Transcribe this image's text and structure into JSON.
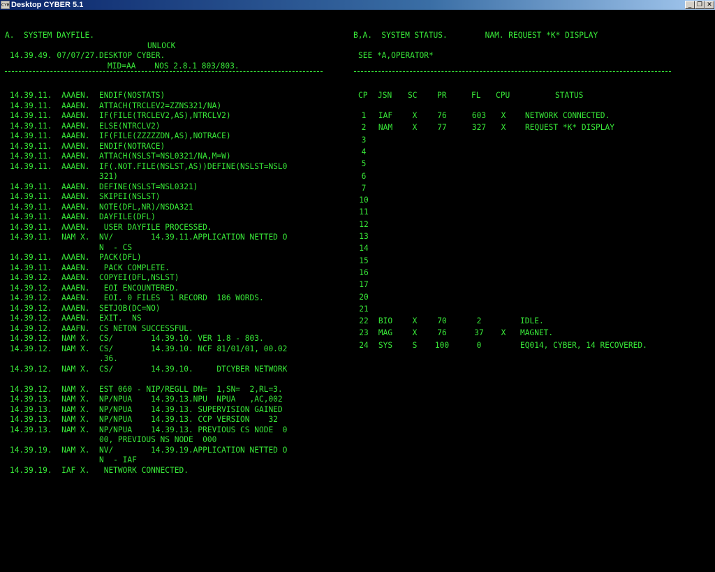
{
  "window": {
    "title": "Desktop CYBER 5.1",
    "icon_text": "CYB",
    "buttons": {
      "minimize": "_",
      "restore": "❐",
      "close": "✕"
    }
  },
  "dayfile": {
    "header": "A.  SYSTEM DAYFILE.",
    "unlock": "UNLOCK",
    "banner1": "14.39.49. 07/07/27.DESKTOP CYBER.",
    "banner2": "MID=AA    NOS 2.8.1 803/803.",
    "lines": [
      "14.39.11.  AAAEN.  ENDIF(NOSTATS)",
      "14.39.11.  AAAEN.  ATTACH(TRCLEV2=ZZNS321/NA)",
      "14.39.11.  AAAEN.  IF(FILE(TRCLEV2,AS),NTRCLV2)",
      "14.39.11.  AAAEN.  ELSE(NTRCLV2)",
      "14.39.11.  AAAEN.  IF(FILE(ZZZZZDN,AS),NOTRACE)",
      "14.39.11.  AAAEN.  ENDIF(NOTRACE)",
      "14.39.11.  AAAEN.  ATTACH(NSLST=NSL0321/NA,M=W)",
      "14.39.11.  AAAEN.  IF(.NOT.FILE(NSLST,AS))DEFINE(NSLST=NSL0",
      "                   321)",
      "14.39.11.  AAAEN.  DEFINE(NSLST=NSL0321)",
      "14.39.11.  AAAEN.  SKIPEI(NSLST)",
      "14.39.11.  AAAEN.  NOTE(DFL,NR)/NSDA321",
      "14.39.11.  AAAEN.  DAYFILE(DFL)",
      "14.39.11.  AAAEN.   USER DAYFILE PROCESSED.",
      "14.39.11.  NAM X.  NV/        14.39.11.APPLICATION NETTED O",
      "                   N  - CS",
      "14.39.11.  AAAEN.  PACK(DFL)",
      "14.39.11.  AAAEN.   PACK COMPLETE.",
      "14.39.12.  AAAEN.  COPYEI(DFL,NSLST)",
      "14.39.12.  AAAEN.   EOI ENCOUNTERED.",
      "14.39.12.  AAAEN.   EOI. 0 FILES  1 RECORD  186 WORDS.",
      "14.39.12.  AAAEN.  SETJOB(DC=NO)",
      "14.39.12.  AAAEN.  EXIT.  NS",
      "14.39.12.  AAAFN.  CS NETON SUCCESSFUL.",
      "14.39.12.  NAM X.  CS/        14.39.10. VER 1.8 - 803.",
      "14.39.12.  NAM X.  CS/        14.39.10. NCF 81/01/01, 00.02",
      "                   .36.",
      "14.39.12.  NAM X.  CS/        14.39.10.     DTCYBER NETWORK",
      "",
      "14.39.12.  NAM X.  EST 060 - NIP/REGLL DN=  1,SN=  2,RL=3.",
      "14.39.13.  NAM X.  NP/NPUA    14.39.13.NPU  NPUA   ,AC,002",
      "14.39.13.  NAM X.  NP/NPUA    14.39.13. SUPERVISION GAINED",
      "14.39.13.  NAM X.  NP/NPUA    14.39.13. CCP VERSION    32",
      "14.39.13.  NAM X.  NP/NPUA    14.39.13. PREVIOUS CS NODE  0",
      "                   00, PREVIOUS NS NODE  000",
      "14.39.19.  NAM X.  NV/        14.39.19.APPLICATION NETTED O",
      "                   N  - IAF",
      "14.39.19.  IAF X.   NETWORK CONNECTED."
    ]
  },
  "status": {
    "header": "B,A.  SYSTEM STATUS.        NAM. REQUEST *K* DISPLAY",
    "see": "SEE *A,OPERATOR*",
    "columns": [
      "CP",
      "JSN",
      "SC",
      "PR",
      "FL",
      "CPU",
      "STATUS"
    ],
    "rows": [
      {
        "cp": "1",
        "jsn": "IAF",
        "sc": "X",
        "pr": "76",
        "fl": "603",
        "cpu": "X",
        "status": "NETWORK CONNECTED."
      },
      {
        "cp": "2",
        "jsn": "NAM",
        "sc": "X",
        "pr": "77",
        "fl": "327",
        "cpu": "X",
        "status": "REQUEST *K* DISPLAY"
      },
      {
        "cp": "3"
      },
      {
        "cp": "4"
      },
      {
        "cp": "5"
      },
      {
        "cp": "6"
      },
      {
        "cp": "7"
      },
      {
        "cp": "10"
      },
      {
        "cp": "11"
      },
      {
        "cp": "12"
      },
      {
        "cp": "13"
      },
      {
        "cp": "14"
      },
      {
        "cp": "15"
      },
      {
        "cp": "16"
      },
      {
        "cp": "17"
      },
      {
        "cp": "20"
      },
      {
        "cp": "21"
      },
      {
        "cp": "22",
        "jsn": "BIO",
        "sc": "X",
        "pr": "70",
        "fl": "2",
        "cpu": "",
        "status": "IDLE."
      },
      {
        "cp": "23",
        "jsn": "MAG",
        "sc": "X",
        "pr": "76",
        "fl": "37",
        "cpu": "X",
        "status": "MAGNET."
      },
      {
        "cp": "24",
        "jsn": "SYS",
        "sc": "S",
        "pr": "100",
        "fl": "0",
        "cpu": "",
        "status": "EQ014, CYBER, 14 RECOVERED."
      }
    ]
  }
}
